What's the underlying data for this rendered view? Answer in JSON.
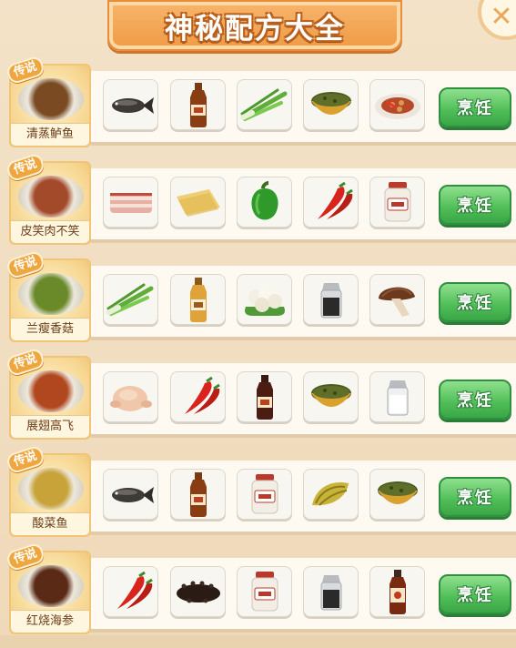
{
  "title": "神秘配方大全",
  "close_icon": "close-x-icon",
  "legend_tag": "传说",
  "cook_label": "烹饪",
  "recipes": [
    {
      "dish": "清蒸鲈鱼",
      "dish_color": "#7a4a22",
      "ingredients": [
        "fish-icon",
        "soy-sauce-bottle-icon",
        "green-onion-icon",
        "pickled-vegetable-bowl-icon",
        "chili-peanut-plate-icon"
      ]
    },
    {
      "dish": "皮笑肉不笑",
      "dish_color": "#a34a2b",
      "ingredients": [
        "pork-belly-icon",
        "tofu-skin-icon",
        "green-pepper-icon",
        "red-chili-icon",
        "starch-jar-icon"
      ]
    },
    {
      "dish": "兰瘦香菇",
      "dish_color": "#6a8a2a",
      "ingredients": [
        "green-onion-icon",
        "cooking-wine-bottle-icon",
        "cauliflower-icon",
        "pepper-shaker-icon",
        "mushroom-icon"
      ]
    },
    {
      "dish": "展翅高飞",
      "dish_color": "#b0471e",
      "ingredients": [
        "chicken-icon",
        "red-chili-icon",
        "vinegar-bottle-icon",
        "pickled-vegetable-bowl-icon",
        "salt-shaker-icon"
      ]
    },
    {
      "dish": "酸菜鱼",
      "dish_color": "#c7a33a",
      "ingredients": [
        "fish-icon",
        "soy-sauce-bottle-icon",
        "starch-jar-icon",
        "sauerkraut-icon",
        "pickled-vegetable-bowl-icon"
      ]
    },
    {
      "dish": "红烧海参",
      "dish_color": "#5a2a16",
      "ingredients": [
        "red-chili-icon",
        "sea-cucumber-icon",
        "starch-jar-icon",
        "pepper-shaker-icon",
        "sauce-bottle-icon"
      ]
    }
  ]
}
